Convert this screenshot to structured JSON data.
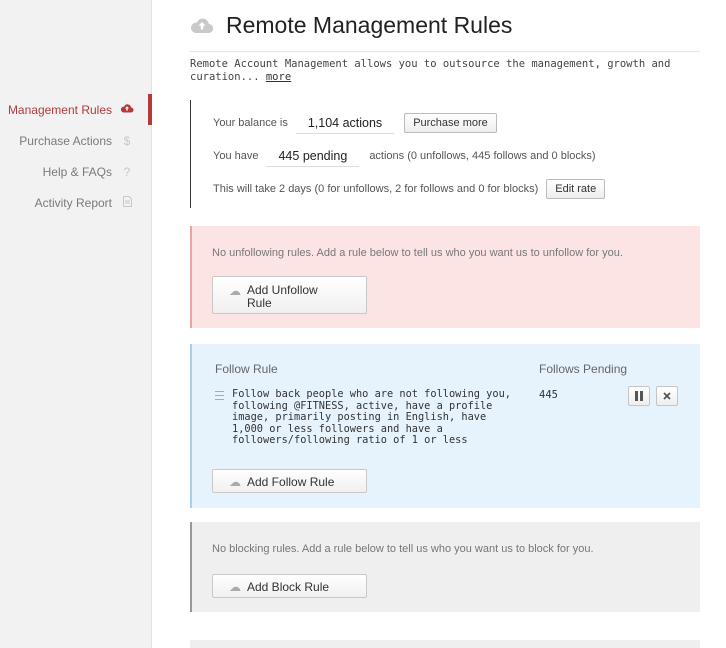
{
  "sidebar": {
    "items": [
      {
        "label": "Management Rules",
        "icon": "cloud-upload-icon",
        "active": true
      },
      {
        "label": "Purchase Actions",
        "icon": "dollar-icon",
        "active": false
      },
      {
        "label": "Help & FAQs",
        "icon": "question-icon",
        "active": false
      },
      {
        "label": "Activity Report",
        "icon": "document-icon",
        "active": false
      }
    ]
  },
  "header": {
    "title": "Remote Management Rules",
    "intro": "Remote Account Management allows you to outsource the management, growth and curation... ",
    "more_link": "more"
  },
  "balance": {
    "balance_prefix": "Your balance is",
    "balance_value": "1,104 actions",
    "purchase_label": "Purchase more",
    "have_prefix": "You have",
    "pending_value": "445 pending",
    "pending_suffix": "actions  (0 unfollows, 445 follows and 0 blocks)",
    "time_text": "This will take 2 days  (0 for unfollows, 2 for follows and 0 for blocks)",
    "edit_rate_label": "Edit rate"
  },
  "unfollow": {
    "message": "No unfollowing rules. Add a rule below to tell us who you want us to unfollow for you.",
    "add_label": "Add Unfollow Rule"
  },
  "follow": {
    "header": "Follow Rule",
    "pending_header": "Follows Pending",
    "rule": "Follow back people who are not following you, following @FITNESS, active, have a profile image, primarily posting in English, have 1,000 or less followers and have a followers/following ratio of 1 or less",
    "pending_count": "445",
    "add_label": "Add Follow Rule"
  },
  "block": {
    "message": "No blocking rules. Add a rule below to tell us who you want us to block for you.",
    "add_label": "Add Block Rule"
  },
  "colors": {
    "accent": "#b5393b",
    "unfollow_bg": "#fde4e4",
    "follow_bg": "#e7f3fc",
    "block_bg": "#efefef"
  }
}
